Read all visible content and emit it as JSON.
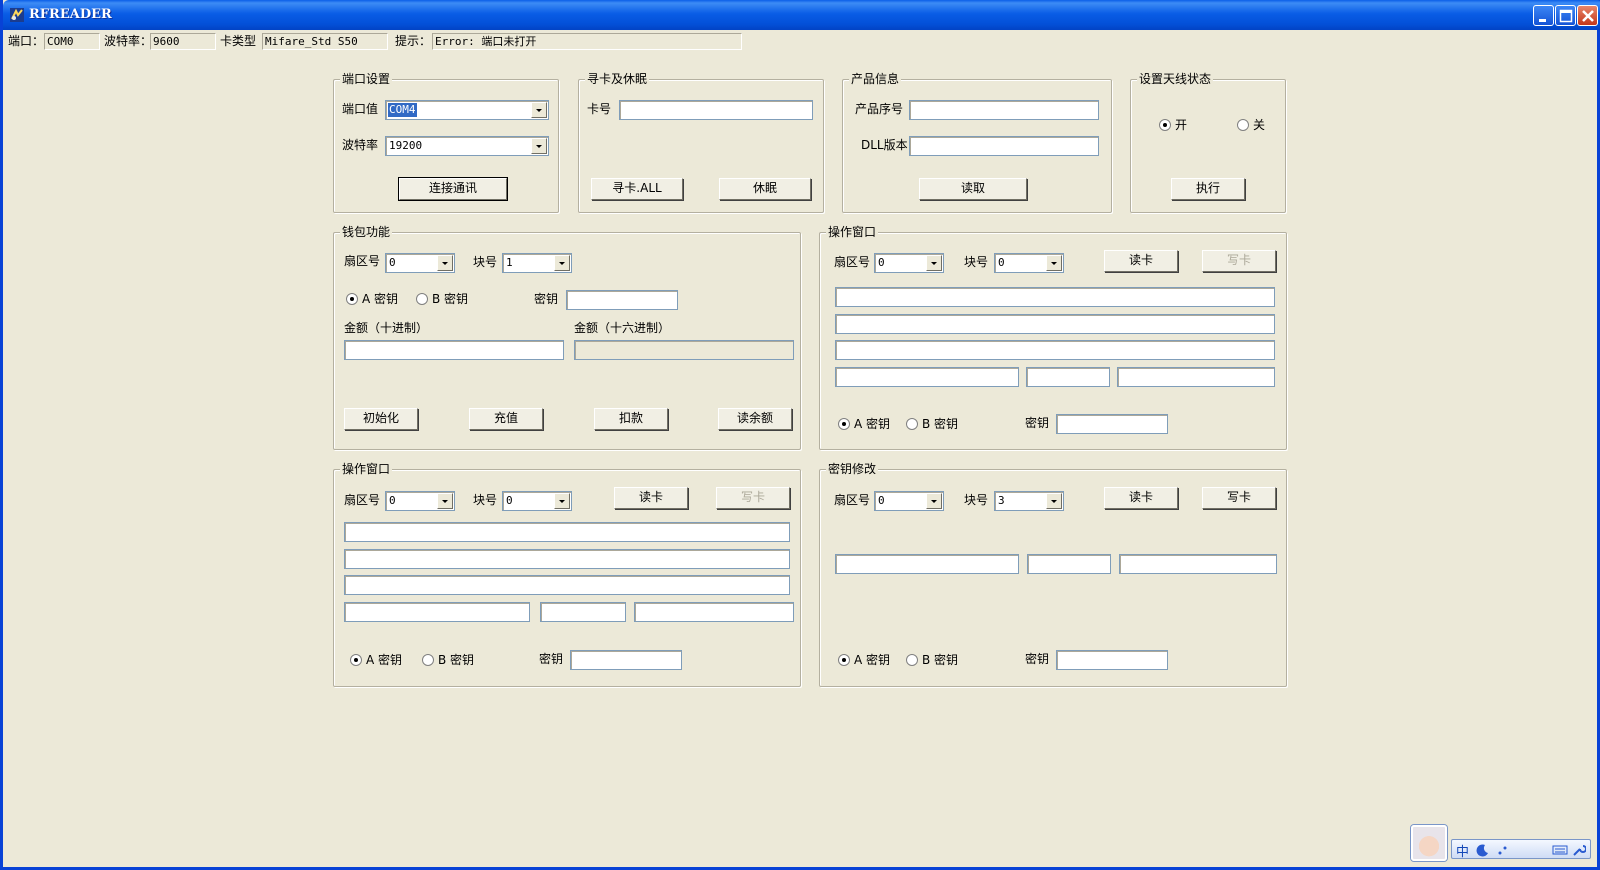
{
  "window": {
    "title": "RFREADER"
  },
  "status": {
    "port_label": "端口：",
    "port_value": "COM0",
    "baud_label": "波特率：",
    "baud_value": "9600",
    "cardtype_label": "卡类型",
    "cardtype_value": "Mifare_Std  S50",
    "hint_label": "提示：",
    "hint_value": "Error:  端口未打开"
  },
  "port_settings": {
    "title": "端口设置",
    "port_label": "端口值",
    "port_value": "COM4",
    "baud_label": "波特率",
    "baud_value": "19200",
    "connect_button": "连接通讯"
  },
  "find_sleep": {
    "title": "寻卡及休眠",
    "card_no_label": "卡号",
    "card_no_value": "",
    "find_button": "寻卡.ALL",
    "sleep_button": "休眠"
  },
  "product_info": {
    "title": "产品信息",
    "serial_label": "产品序号",
    "serial_value": "",
    "dll_label": "DLL版本",
    "dll_value": "",
    "read_button": "读取"
  },
  "antenna": {
    "title": "设置天线状态",
    "on_label": "开",
    "off_label": "关",
    "selected": "on",
    "exec_button": "执行"
  },
  "wallet": {
    "title": "钱包功能",
    "sector_label": "扇区号",
    "sector_value": "0",
    "block_label": "块号",
    "block_value": "1",
    "key_a_label": "A 密钥",
    "key_b_label": "B 密钥",
    "key_label": "密钥",
    "key_value": "",
    "amount_dec_label": "金额（十进制）",
    "amount_hex_label": "金额（十六进制）",
    "init_button": "初始化",
    "recharge_button": "充值",
    "deduct_button": "扣款",
    "balance_button": "读余额"
  },
  "op_window_1": {
    "title": "操作窗口",
    "sector_label": "扇区号",
    "sector_value": "0",
    "block_label": "块号",
    "block_value": "0",
    "read_button": "读卡",
    "write_button": "写卡",
    "key_a_label": "A 密钥",
    "key_b_label": "B 密钥",
    "key_label": "密钥"
  },
  "op_window_2": {
    "title": "操作窗口",
    "sector_label": "扇区号",
    "sector_value": "0",
    "block_label": "块号",
    "block_value": "0",
    "read_button": "读卡",
    "write_button": "写卡",
    "key_a_label": "A 密钥",
    "key_b_label": "B 密钥",
    "key_label": "密钥"
  },
  "key_change": {
    "title": "密钥修改",
    "sector_label": "扇区号",
    "sector_value": "0",
    "block_label": "块号",
    "block_value": "3",
    "read_button": "读卡",
    "write_button": "写卡",
    "key_a_label": "A 密钥",
    "key_b_label": "B 密钥",
    "key_label": "密钥"
  },
  "tray": {
    "ime_label": "中"
  },
  "icons": [
    "app-icon",
    "minimize-icon",
    "maximize-icon",
    "close-icon",
    "dropdown-arrow-icon",
    "avatar",
    "moon-icon",
    "keyboard-icon",
    "wrench-icon"
  ]
}
